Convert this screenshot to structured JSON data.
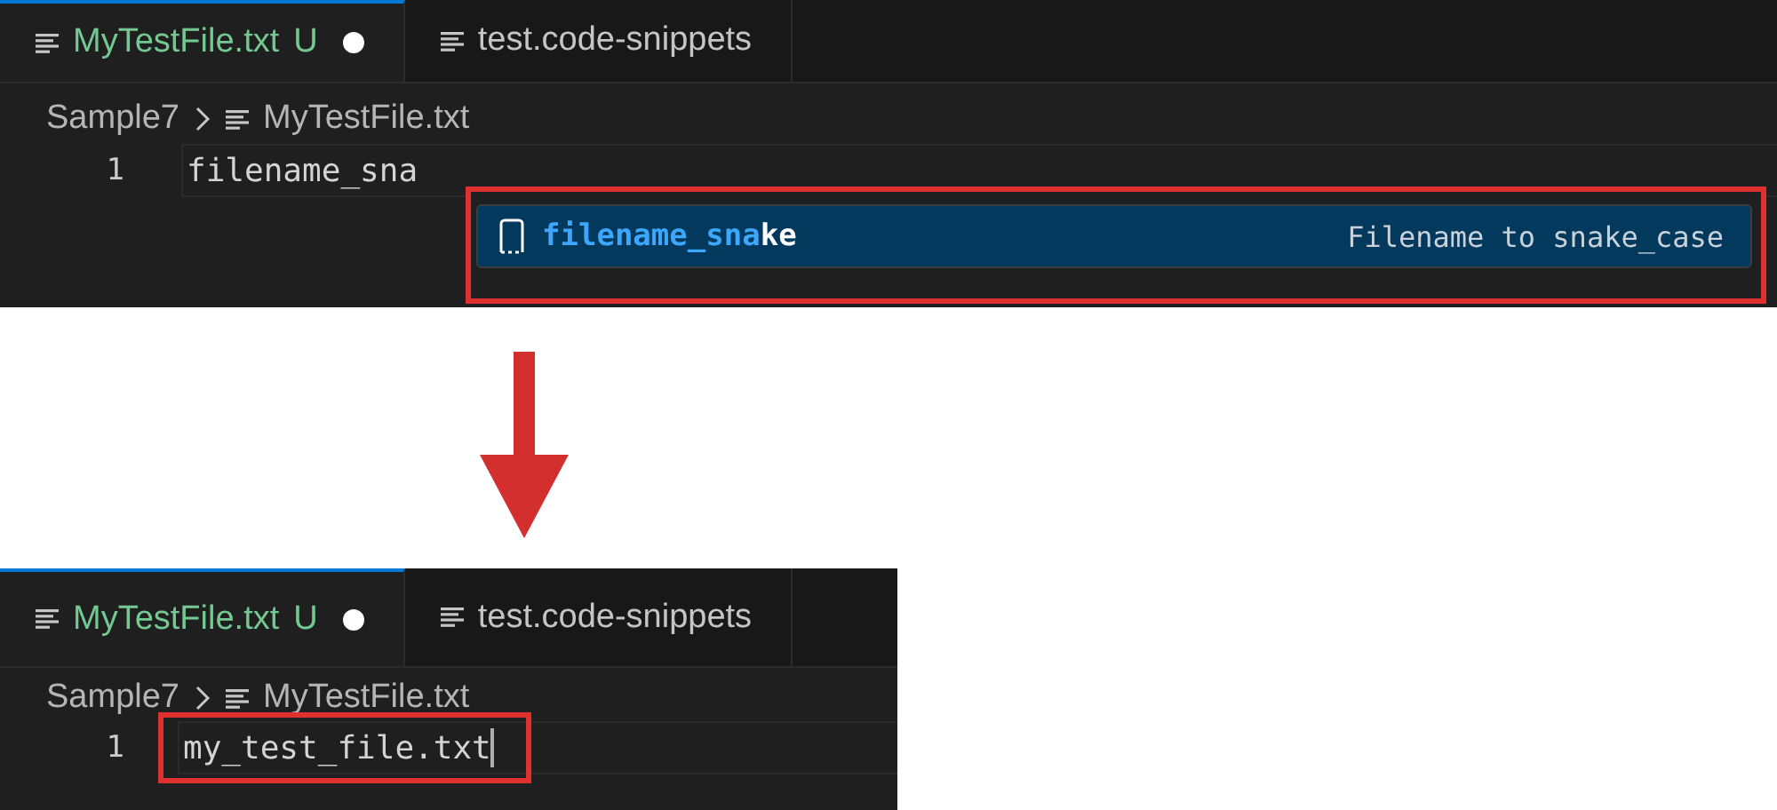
{
  "panels": [
    {
      "tabs": [
        {
          "label": "MyTestFile.txt",
          "badge": "U",
          "dirty": true,
          "selected": true
        },
        {
          "label": "test.code-snippets",
          "dirty": false,
          "selected": false
        }
      ],
      "breadcrumb": {
        "folder": "Sample7",
        "file": "MyTestFile.txt"
      },
      "lines": [
        {
          "number": "1",
          "text": "filename_sna",
          "cursor": false,
          "annotated": false
        }
      ],
      "suggestion": {
        "match": "filename_sna",
        "rest": "ke",
        "detail": "Filename to snake_case",
        "annotated": true
      }
    },
    {
      "tabs": [
        {
          "label": "MyTestFile.txt",
          "badge": "U",
          "dirty": true,
          "selected": true
        },
        {
          "label": "test.code-snippets",
          "dirty": false,
          "selected": false
        }
      ],
      "breadcrumb": {
        "folder": "Sample7",
        "file": "MyTestFile.txt"
      },
      "lines": [
        {
          "number": "1",
          "text": "my_test_file.txt",
          "cursor": true,
          "annotated": true
        }
      ]
    }
  ]
}
